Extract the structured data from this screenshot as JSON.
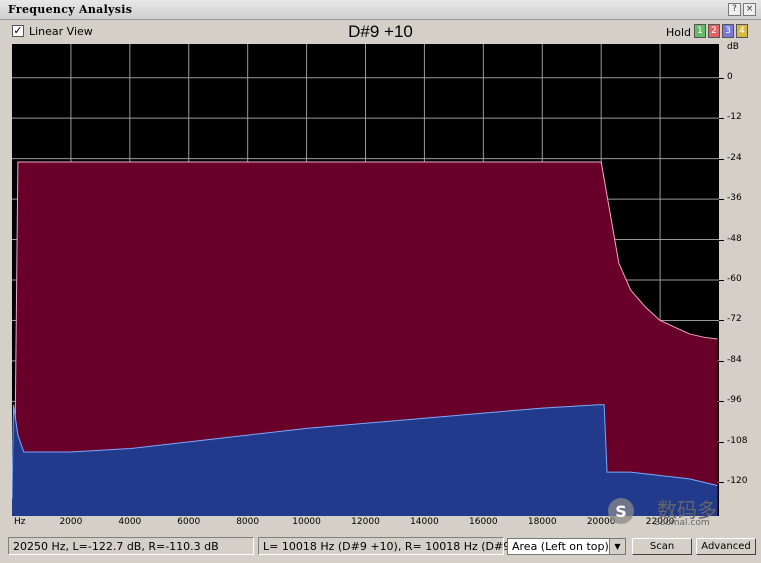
{
  "window": {
    "title": "Frequency Analysis",
    "help_glyph": "?",
    "close_glyph": "×"
  },
  "toolbar": {
    "linear_view_label": "Linear View",
    "linear_view_checked": true,
    "note_title": "D#9 +10",
    "hold_label": "Hold",
    "hold_buttons": [
      {
        "label": "1",
        "color": "#66bb66"
      },
      {
        "label": "2",
        "color": "#e06666"
      },
      {
        "label": "3",
        "color": "#7a7ad6"
      },
      {
        "label": "4",
        "color": "#d8b840"
      }
    ]
  },
  "y_axis": {
    "unit": "dB",
    "ticks": [
      "0",
      "-12",
      "-24",
      "-36",
      "-48",
      "-60",
      "-72",
      "-84",
      "-96",
      "-108",
      "-120"
    ]
  },
  "x_axis": {
    "unit": "Hz",
    "ticks": [
      "2000",
      "4000",
      "6000",
      "8000",
      "10000",
      "12000",
      "14000",
      "16000",
      "18000",
      "20000",
      "22000"
    ]
  },
  "chart_data": {
    "type": "area",
    "xlabel": "Hz",
    "ylabel": "dB",
    "xlim": [
      0,
      24000
    ],
    "ylim": [
      -130,
      10
    ],
    "grid": true,
    "background": "#000000",
    "grid_color": "#9a9a9a",
    "series": [
      {
        "color": "#680029",
        "line_color": "#f0a8c8",
        "x": [
          0,
          100,
          200,
          20000,
          20300,
          20600,
          21000,
          21500,
          22000,
          22500,
          23000,
          23500,
          23950
        ],
        "y": [
          -125,
          -110,
          -25,
          -25,
          -40,
          -55,
          -63,
          -68,
          -72,
          -74,
          -76,
          -77,
          -77.5
        ]
      },
      {
        "color": "#223a8c",
        "line_color": "#7aa8ff",
        "x": [
          0,
          50,
          200,
          400,
          2000,
          4000,
          6000,
          8000,
          10000,
          12000,
          14000,
          16000,
          18000,
          19900,
          20100,
          20200,
          21000,
          22000,
          23000,
          23950
        ],
        "y": [
          -125,
          -97,
          -106,
          -111,
          -111,
          -110,
          -108,
          -106,
          -104,
          -102.5,
          -101,
          -99.5,
          -98,
          -97,
          -97,
          -117,
          -117,
          -118,
          -119,
          -121
        ]
      }
    ]
  },
  "status": {
    "cursor_readout": "20250 Hz, L=-122.7 dB, R=-110.3 dB",
    "peak_readout": "L=  10018 Hz (D#9 +10), R=  10018 Hz (D#9 +10)",
    "view_mode": "Area (Left on top)",
    "scan_button": "Scan",
    "advanced_button": "Advanced"
  },
  "watermark": {
    "text_cn": "数码多",
    "text_url": "Soomal.com",
    "color": "#6a6a6a"
  }
}
